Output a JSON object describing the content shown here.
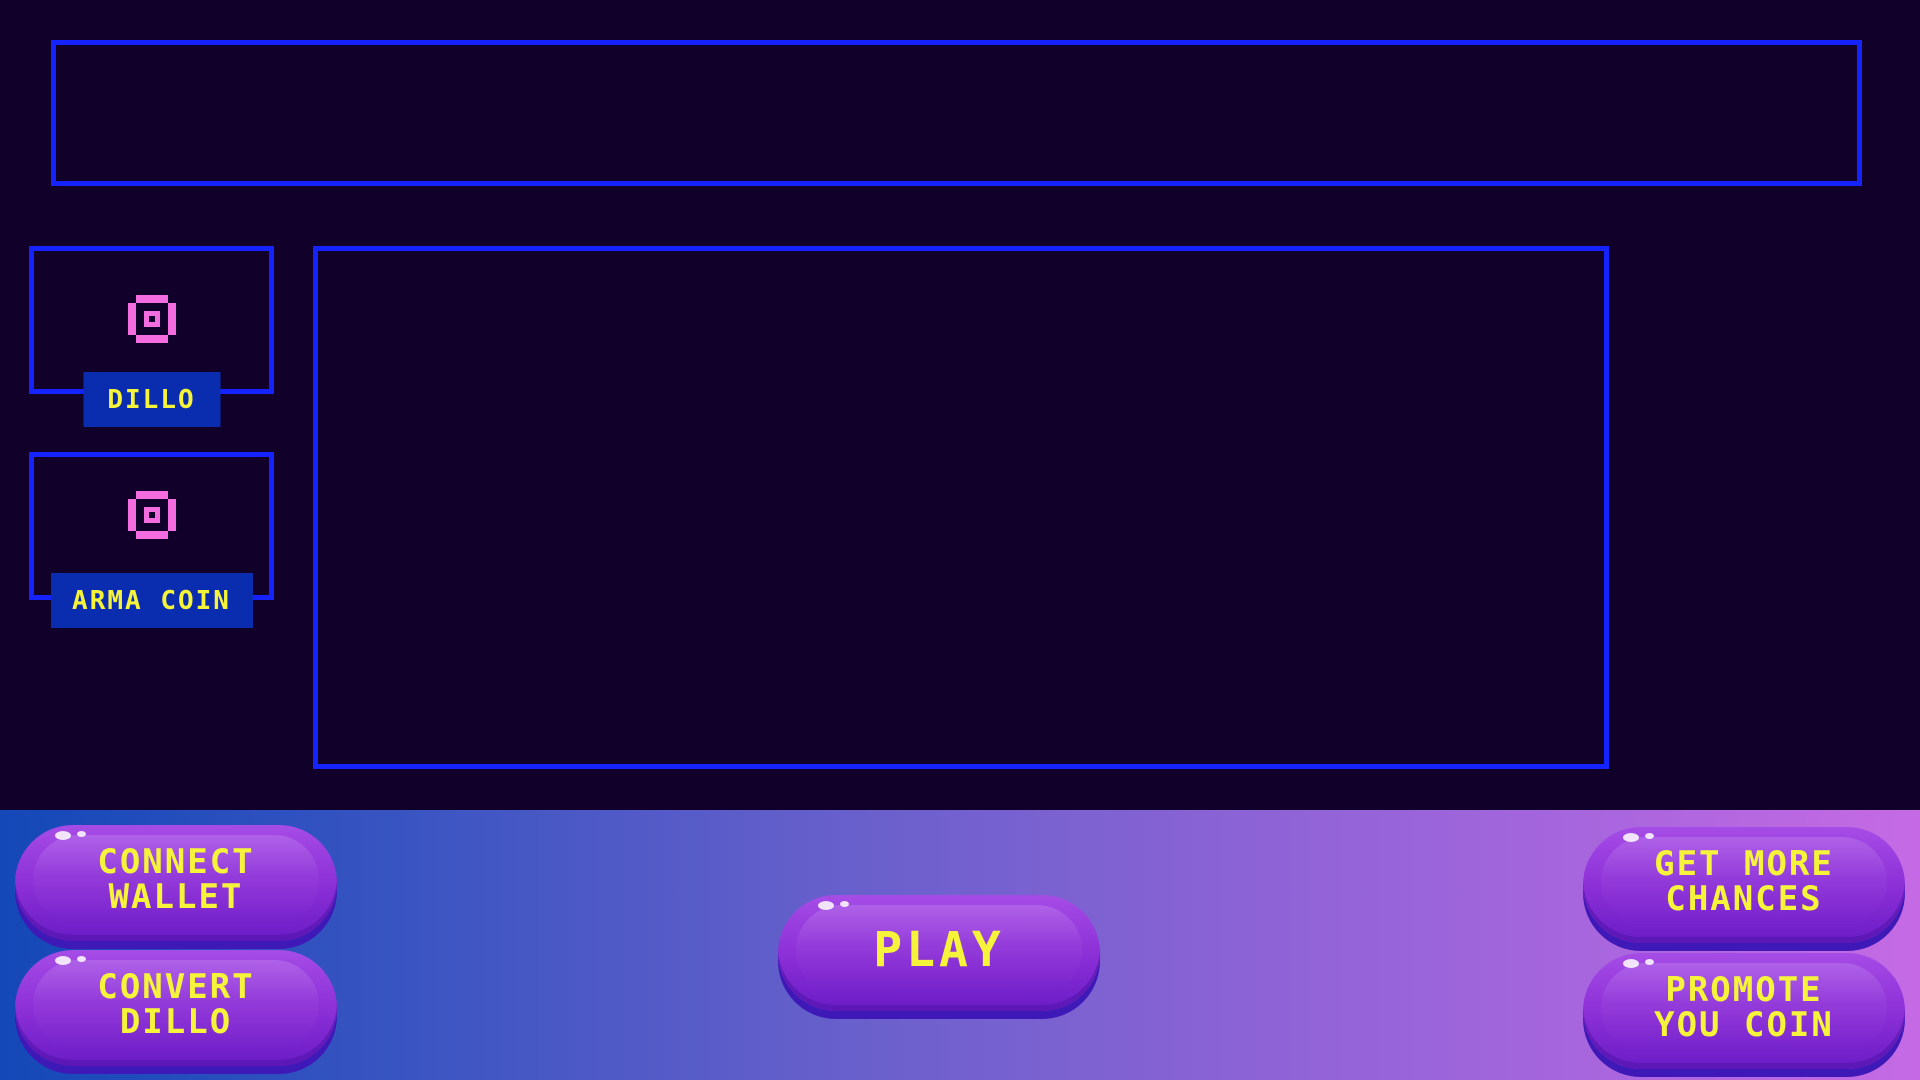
{
  "colors": {
    "background": "#11002a",
    "panel_border": "#1524ff",
    "label_background": "#0a2cae",
    "label_text": "#f6f43a",
    "coin_icon": "#f36ce0",
    "button_purple": "#8a2ed6"
  },
  "sidebar": {
    "coins": [
      {
        "label": "DILLO",
        "icon": "pixel-coin-icon"
      },
      {
        "label": "ARMA COIN",
        "icon": "pixel-coin-icon"
      }
    ]
  },
  "buttons": {
    "connect_wallet": "CONNECT\nWALLET",
    "convert_dillo": "CONVERT\nDILLO",
    "play": "PLAY",
    "get_more_chances": "GET MORE\nCHANCES",
    "promote_coin": "PROMOTE\nYOU COIN"
  }
}
